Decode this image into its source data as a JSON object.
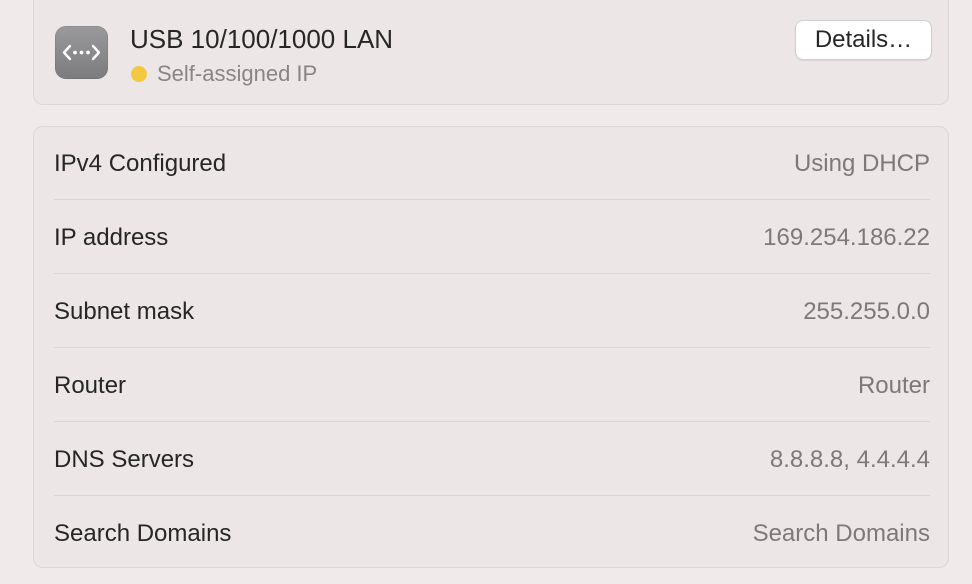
{
  "connection": {
    "name": "USB 10/100/1000 LAN",
    "status": "Self-assigned IP",
    "status_color": "#f5c842",
    "icon": "network-icon",
    "details_label": "Details…"
  },
  "info": {
    "rows": [
      {
        "label": "IPv4 Configured",
        "value": "Using DHCP"
      },
      {
        "label": "IP address",
        "value": "169.254.186.22"
      },
      {
        "label": "Subnet mask",
        "value": "255.255.0.0"
      },
      {
        "label": "Router",
        "value": "Router"
      },
      {
        "label": "DNS Servers",
        "value": "8.8.8.8, 4.4.4.4"
      },
      {
        "label": "Search Domains",
        "value": "Search Domains"
      }
    ]
  }
}
